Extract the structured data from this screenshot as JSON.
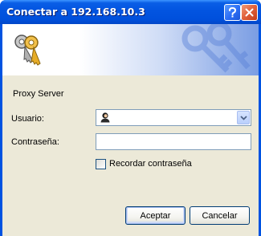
{
  "window": {
    "title": "Conectar a 192.168.10.3",
    "icons": {
      "help": "help-icon",
      "close": "close-icon",
      "banner": "keys-icon"
    }
  },
  "form": {
    "realm": "Proxy Server",
    "username_label": "Usuario:",
    "username_value": "",
    "password_label": "Contraseña:",
    "password_value": "",
    "remember_label": "Recordar contraseña",
    "remember_checked": false
  },
  "buttons": {
    "ok": "Aceptar",
    "cancel": "Cancelar"
  },
  "colors": {
    "titlebar": "#0054e3",
    "dialog_bg": "#ece9d8",
    "field_border": "#7f9db9",
    "button_border": "#003c74"
  }
}
